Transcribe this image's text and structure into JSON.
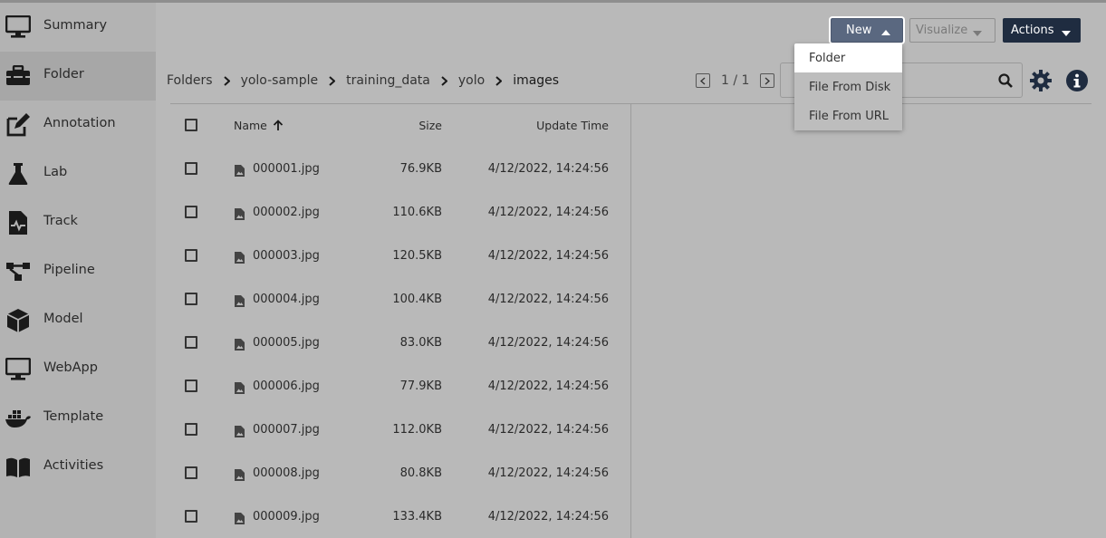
{
  "sidebar": {
    "items": [
      {
        "label": "Summary",
        "icon": "monitor-icon"
      },
      {
        "label": "Folder",
        "icon": "toolbox-icon",
        "active": true
      },
      {
        "label": "Annotation",
        "icon": "edit-icon"
      },
      {
        "label": "Lab",
        "icon": "flask-icon"
      },
      {
        "label": "Track",
        "icon": "file-pulse-icon"
      },
      {
        "label": "Pipeline",
        "icon": "pipeline-icon"
      },
      {
        "label": "Model",
        "icon": "cube-icon"
      },
      {
        "label": "WebApp",
        "icon": "monitor-icon"
      },
      {
        "label": "Template",
        "icon": "docker-icon"
      },
      {
        "label": "Activities",
        "icon": "book-icon"
      }
    ]
  },
  "toolbar": {
    "new_label": "New",
    "visualize_label": "Visualize",
    "actions_label": "Actions"
  },
  "new_menu": {
    "items": [
      "Folder",
      "File From Disk",
      "File From URL"
    ]
  },
  "breadcrumb": [
    "Folders",
    "yolo-sample",
    "training_data",
    "yolo",
    "images"
  ],
  "pager": {
    "text": "1 / 1"
  },
  "search": {
    "placeholder": "",
    "value": ""
  },
  "table": {
    "headers": {
      "name": "Name",
      "size": "Size",
      "time": "Update Time"
    },
    "rows": [
      {
        "name": "000001.jpg",
        "size": "76.9KB",
        "time": "4/12/2022, 14:24:56"
      },
      {
        "name": "000002.jpg",
        "size": "110.6KB",
        "time": "4/12/2022, 14:24:56"
      },
      {
        "name": "000003.jpg",
        "size": "120.5KB",
        "time": "4/12/2022, 14:24:56"
      },
      {
        "name": "000004.jpg",
        "size": "100.4KB",
        "time": "4/12/2022, 14:24:56"
      },
      {
        "name": "000005.jpg",
        "size": "83.0KB",
        "time": "4/12/2022, 14:24:56"
      },
      {
        "name": "000006.jpg",
        "size": "77.9KB",
        "time": "4/12/2022, 14:24:56"
      },
      {
        "name": "000007.jpg",
        "size": "112.0KB",
        "time": "4/12/2022, 14:24:56"
      },
      {
        "name": "000008.jpg",
        "size": "80.8KB",
        "time": "4/12/2022, 14:24:56"
      },
      {
        "name": "000009.jpg",
        "size": "133.4KB",
        "time": "4/12/2022, 14:24:56"
      }
    ]
  },
  "colors": {
    "new_button": "#5a6880",
    "actions_button": "#1f2c40",
    "info_icon": "#1f2c40"
  }
}
